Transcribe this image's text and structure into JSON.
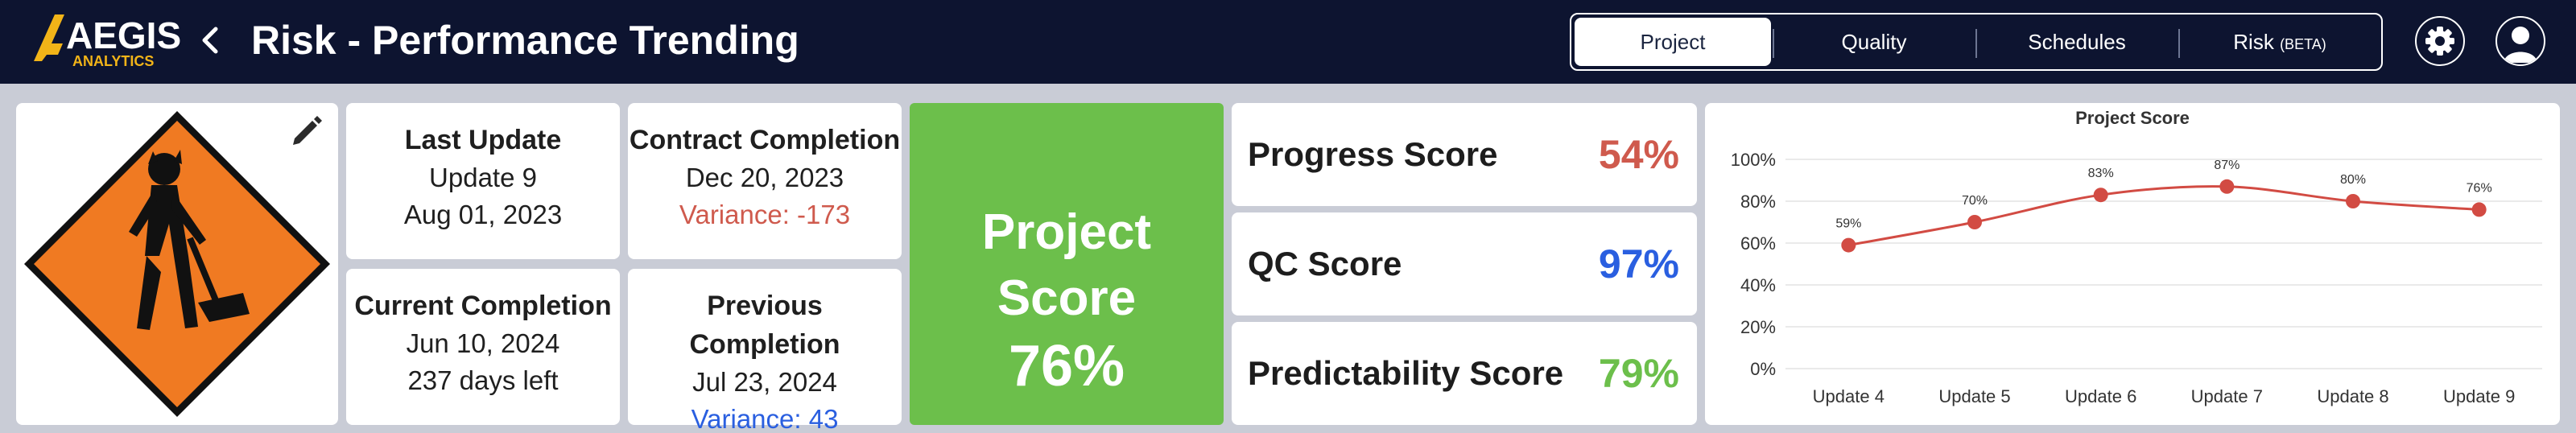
{
  "header": {
    "logo_text": "AEGIS",
    "logo_sub": "ANALYTICS",
    "back_icon": "chevron-left-icon",
    "title": "Risk - Performance Trending",
    "tabs": [
      {
        "label": "Project",
        "active": true
      },
      {
        "label": "Quality",
        "active": false
      },
      {
        "label": "Schedules",
        "active": false
      },
      {
        "label": "Risk",
        "badge": "(BETA)",
        "active": false
      }
    ],
    "icons": [
      "gear-icon",
      "user-icon"
    ]
  },
  "info": {
    "last_update": {
      "label": "Last Update",
      "line1": "Update 9",
      "line2": "Aug 01, 2023"
    },
    "contract_completion": {
      "label": "Contract Completion",
      "line1": "Dec 20, 2023",
      "line2": "Variance: -173"
    },
    "current_completion": {
      "label": "Current Completion",
      "line1": "Jun 10, 2024",
      "line2": "237 days left"
    },
    "previous_completion": {
      "label": "Previous Completion",
      "line1": "Jul 23, 2024",
      "line2": "Variance: 43"
    }
  },
  "project_score": {
    "label": "Project Score",
    "value": "76%"
  },
  "scores": [
    {
      "label": "Progress Score",
      "value": "54%",
      "color": "#cf5a4d"
    },
    {
      "label": "QC Score",
      "value": "97%",
      "color": "#2a5fe0"
    },
    {
      "label": "Predictability Score",
      "value": "79%",
      "color": "#6cbf4b"
    }
  ],
  "colors": {
    "header_bg": "#0d1430",
    "project_score_bg": "#6cbf4b",
    "sign_orange": "#f07a22",
    "chart_line": "#d24b43"
  },
  "chart_data": {
    "type": "line",
    "title": "Project Score",
    "categories": [
      "Update 4",
      "Update 5",
      "Update 6",
      "Update 7",
      "Update 8",
      "Update 9"
    ],
    "values": [
      59,
      70,
      83,
      87,
      80,
      76
    ],
    "data_labels": [
      "59%",
      "70%",
      "83%",
      "87%",
      "80%",
      "76%"
    ],
    "y_ticks": [
      "0%",
      "20%",
      "40%",
      "60%",
      "80%",
      "100%"
    ],
    "ylim": [
      0,
      100
    ],
    "grid": true,
    "xlabel": "",
    "ylabel": ""
  }
}
